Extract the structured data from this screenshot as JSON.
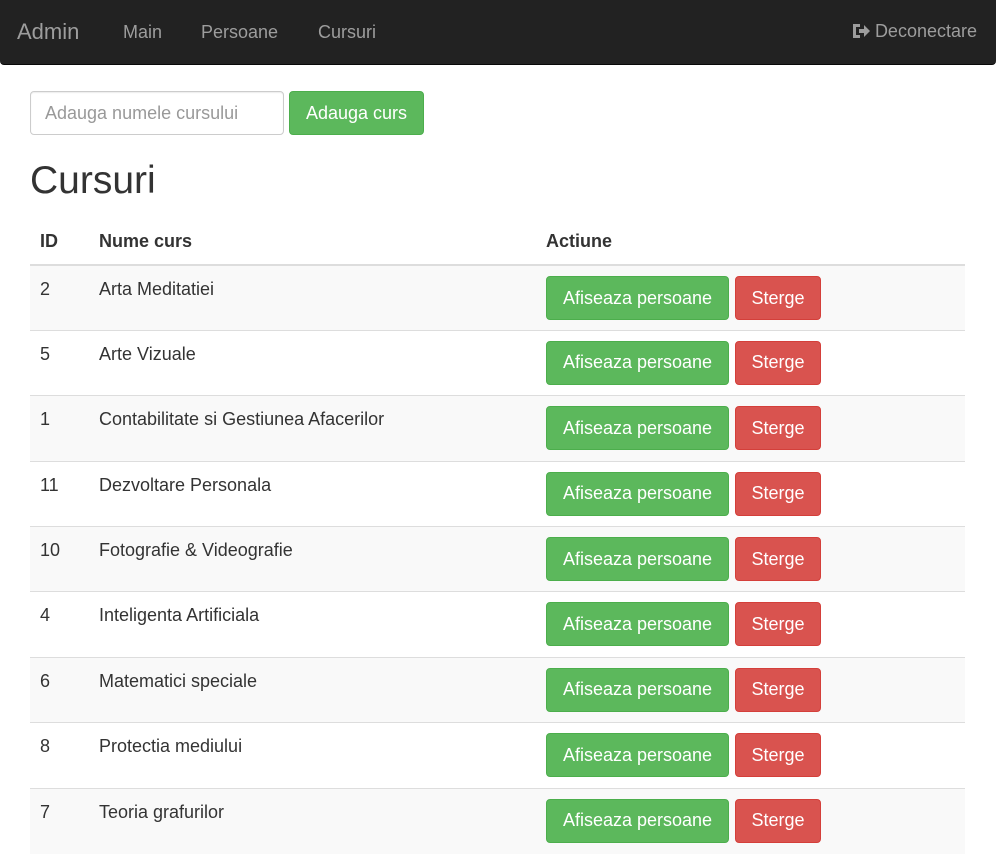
{
  "navbar": {
    "brand": "Admin",
    "links": [
      "Main",
      "Persoane",
      "Cursuri"
    ],
    "logout_label": "Deconectare"
  },
  "add_form": {
    "placeholder": "Adauga numele cursului",
    "value": "",
    "button_label": "Adauga curs"
  },
  "page_title": "Cursuri",
  "table": {
    "headers": [
      "ID",
      "Nume curs",
      "Actiune"
    ],
    "rows": [
      {
        "id": "2",
        "name": "Arta Meditatiei"
      },
      {
        "id": "5",
        "name": "Arte Vizuale"
      },
      {
        "id": "1",
        "name": "Contabilitate si Gestiunea Afacerilor"
      },
      {
        "id": "11",
        "name": "Dezvoltare Personala"
      },
      {
        "id": "10",
        "name": "Fotografie & Videografie"
      },
      {
        "id": "4",
        "name": "Inteligenta Artificiala"
      },
      {
        "id": "6",
        "name": "Matematici speciale"
      },
      {
        "id": "8",
        "name": "Protectia mediului"
      },
      {
        "id": "7",
        "name": "Teoria grafurilor"
      }
    ],
    "show_label": "Afiseaza persoane",
    "delete_label": "Sterge"
  },
  "colors": {
    "navbar_bg": "#222222",
    "success": "#5cb85c",
    "danger": "#d9534f"
  },
  "icons": {
    "logout": "logout-icon"
  }
}
